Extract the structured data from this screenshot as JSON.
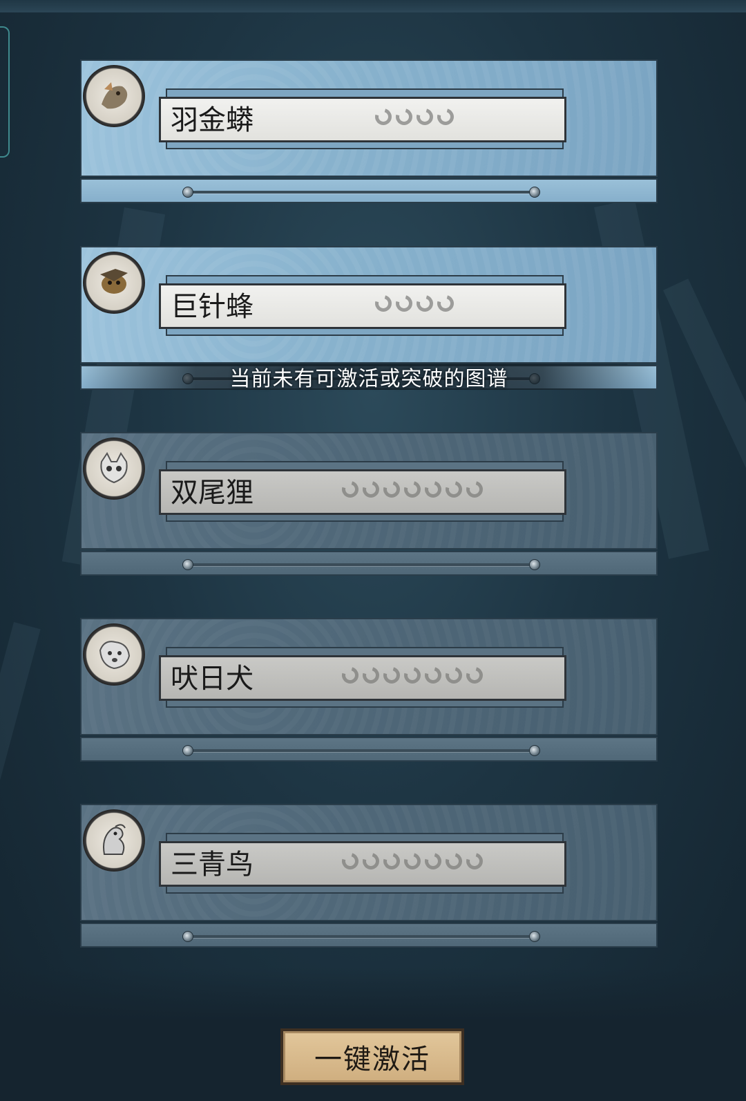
{
  "beasts": [
    {
      "name": "羽金蟒",
      "swirl_count": 4,
      "state": "active",
      "icon": "golden-python-portrait-icon"
    },
    {
      "name": "巨针蜂",
      "swirl_count": 4,
      "state": "active",
      "icon": "giant-hornet-portrait-icon"
    },
    {
      "name": "双尾狸",
      "swirl_count": 7,
      "state": "inactive",
      "icon": "twin-tail-cat-portrait-icon"
    },
    {
      "name": "吠日犬",
      "swirl_count": 7,
      "state": "inactive",
      "icon": "sun-barking-dog-portrait-icon"
    },
    {
      "name": "三青鸟",
      "swirl_count": 7,
      "state": "inactive",
      "icon": "three-blue-bird-portrait-icon"
    }
  ],
  "notice": "当前未有可激活或突破的图谱",
  "activate_button": {
    "label": "一键激活"
  },
  "colors": {
    "active_card": "#8fb8d3",
    "inactive_card": "#526a7b",
    "button": "#d9bb8c",
    "background": "#1d3442"
  }
}
